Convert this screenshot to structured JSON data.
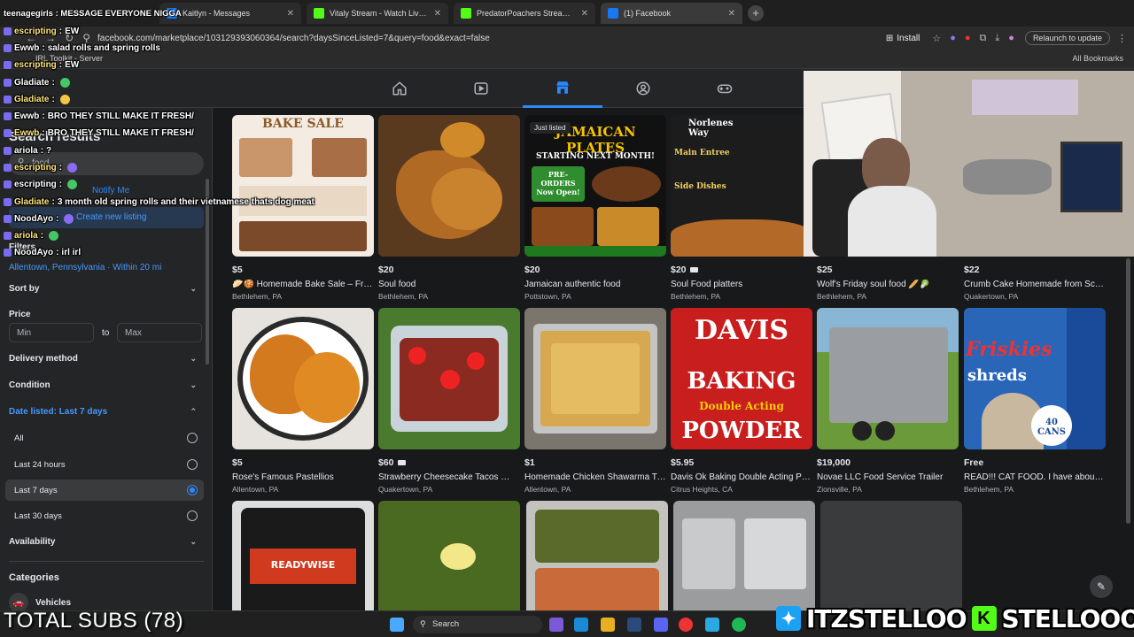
{
  "browser": {
    "tabs": [
      {
        "title": "Kaitlyn - Messages",
        "active": false,
        "color": "#1877f2"
      },
      {
        "title": "Vitaly Stream - Watch Live on Kick",
        "active": false,
        "color": "#53fc18"
      },
      {
        "title": "PredatorPoachers Stream - Watch",
        "active": false,
        "color": "#53fc18"
      },
      {
        "title": "(1) Facebook",
        "active": true,
        "color": "#1877f2"
      }
    ],
    "url": "facebook.com/marketplace/103129393060364/search?daysSinceListed=7&query=food&exact=false",
    "install_label": "Install",
    "relaunch_label": "Relaunch to update",
    "bookmarks_left": "IRL Toolkit - Server",
    "bookmarks_right": "All Bookmarks"
  },
  "overlay": {
    "top_message": "teenagegirls : MESSAGE EVERYONE NIGGA",
    "chat": [
      {
        "user": "escripting",
        "text": "EW"
      },
      {
        "user": "Ewwb",
        "text": "salad rolls and spring rolls"
      },
      {
        "user": "escripting",
        "text": "EW"
      },
      {
        "user": "Gladiate",
        "text": ""
      },
      {
        "user": "Gladiate",
        "text": ""
      },
      {
        "user": "Ewwb",
        "text": "BRO THEY STILL MAKE IT FRESH/"
      },
      {
        "user": "Ewwb",
        "text": "BRO THEY STILL MAKE IT FRESH/"
      },
      {
        "user": "ariola",
        "text": "?"
      },
      {
        "user": "escripting",
        "text": ""
      },
      {
        "user": "escripting",
        "text": ""
      },
      {
        "user": "Gladiate",
        "text": "3 month old spring rolls and their vietnamese thats dog meat"
      },
      {
        "user": "NoodAyo",
        "text": ""
      },
      {
        "user": "ariola",
        "text": ""
      },
      {
        "user": "NoodAyo",
        "text": "irl irl"
      }
    ],
    "subs": "TOTAL SUBS (78)",
    "socials": [
      "ITZSTELLOO",
      "STELLOOO"
    ]
  },
  "sidebar": {
    "title": "Search results",
    "search_value": "food",
    "notify": "Notify Me",
    "create": "Create new listing",
    "filters": "Filters",
    "location": "Allentown, Pennsylvania · Within 20 mi",
    "sort_by": "Sort by",
    "price": "Price",
    "min_placeholder": "Min",
    "max_placeholder": "Max",
    "to": "to",
    "delivery": "Delivery method",
    "condition": "Condition",
    "date_listed": "Date listed: Last 7 days",
    "date_options": [
      {
        "label": "All",
        "selected": false
      },
      {
        "label": "Last 24 hours",
        "selected": false
      },
      {
        "label": "Last 7 days",
        "selected": true
      },
      {
        "label": "Last 30 days",
        "selected": false
      }
    ],
    "availability": "Availability",
    "categories": "Categories",
    "category_item": "Vehicles"
  },
  "listings": [
    {
      "price": "$5",
      "title": "🥟🍪 Homemade Bake Sale – Fresh...",
      "location": "Bethlehem, PA",
      "video": false,
      "badge": ""
    },
    {
      "price": "$20",
      "title": "Soul food",
      "location": "Bethlehem, PA",
      "video": false,
      "badge": ""
    },
    {
      "price": "$20",
      "title": "Jamaican authentic food",
      "location": "Pottstown, PA",
      "video": false,
      "badge": "Just listed"
    },
    {
      "price": "$20",
      "title": "Soul Food platters",
      "location": "Bethlehem, PA",
      "video": true,
      "badge": ""
    },
    {
      "price": "$25",
      "title": "Wolf's Friday soul food 🥖🥬",
      "location": "Bethlehem, PA",
      "video": false,
      "badge": ""
    },
    {
      "price": "$22",
      "title": "Crumb Cake Homemade from Scratch",
      "location": "Quakertown, PA",
      "video": false,
      "badge": ""
    },
    {
      "price": "$5",
      "title": "Rose's Famous Pastellios",
      "location": "Allentown, PA",
      "video": false,
      "badge": ""
    },
    {
      "price": "$60",
      "title": "Strawberry Cheesecake Tacos 🍓🌮",
      "location": "Quakertown, PA",
      "video": true,
      "badge": ""
    },
    {
      "price": "$1",
      "title": "Homemade Chicken Shawarma Tr...",
      "location": "Allentown, PA",
      "video": false,
      "badge": ""
    },
    {
      "price": "$5.95",
      "title": "Davis Ok Baking Double Acting Po...",
      "location": "Citrus Heights, CA",
      "video": false,
      "badge": ""
    },
    {
      "price": "$19,000",
      "title": "Novae LLC Food Service Trailer",
      "location": "Zionsville, PA",
      "video": false,
      "badge": ""
    },
    {
      "price": "Free",
      "title": "READ!!! CAT FOOD. I have about 4...",
      "location": "Bethlehem, PA",
      "video": false,
      "badge": ""
    }
  ],
  "posters": {
    "bake_sale": "BAKE SALE",
    "jamaican": "JAMAICAN PLATES",
    "jamaican_sub": "STARTING NEXT MONTH!",
    "preorder": "PRE-ORDERS Now Open!",
    "norlenes": "Norlenes Way",
    "main_entree": "Main Entree",
    "side_dishes": "Side Dishes",
    "davis1": "DAVIS",
    "davis2": "BAKING",
    "davis3": "Double Acting",
    "davis4": "POWDER",
    "friskies": "Friskies",
    "shreds": "shreds",
    "cans": "40 CANS",
    "readywise": "READYWISE"
  },
  "taskbar": {
    "search": "Search"
  },
  "colors": {
    "accent": "#2d88ff",
    "bg": "#18191a",
    "panel": "#242526"
  }
}
